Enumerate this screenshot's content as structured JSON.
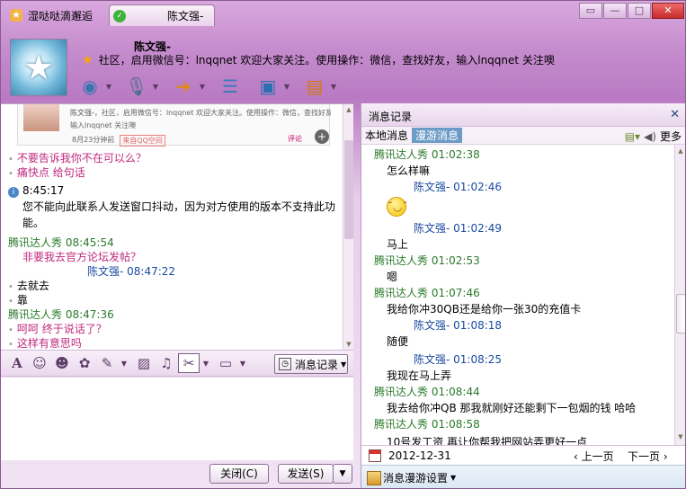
{
  "window": {
    "tabs": [
      {
        "label": "湿哒哒滴邂逅"
      },
      {
        "label": "陈文强-"
      }
    ],
    "buttons": {
      "minimize": "▭",
      "restore": "—",
      "maximize": "□",
      "close": "✕"
    }
  },
  "contact": {
    "name": "陈文强-",
    "signature": "社区，启用微信号：lnqqnet 欢迎大家关注。使用操作：微信，查找好友，输入lnqqnet 关注噢"
  },
  "top_toolbar": [
    {
      "icon": "webcam-icon",
      "glyph": "◉"
    },
    {
      "icon": "microphone-icon",
      "glyph": "♪"
    },
    {
      "icon": "transfer-file-icon",
      "glyph": "➔"
    },
    {
      "icon": "message-icon",
      "glyph": "☰"
    },
    {
      "icon": "remote-desktop-icon",
      "glyph": "▣"
    },
    {
      "icon": "app-icon",
      "glyph": "▤"
    }
  ],
  "preview_card": {
    "name": "陈文强-",
    "title": "社区，启用微信号：lnqqnet 欢迎大家关注。使用操作：微信，查找好友，",
    "message": "输入lnqqnet 关注噢",
    "time": "8月23分钟前",
    "badge": "来自QQ空间",
    "comment": "评论"
  },
  "chat": {
    "lines": [
      {
        "type": "bullet",
        "text": "不要告诉我你不在可以么？",
        "style": "pink"
      },
      {
        "type": "bullet",
        "text": "痛快点   给句话",
        "style": "pink"
      },
      {
        "type": "sys",
        "text": "8:45:17"
      },
      {
        "type": "plain",
        "text": "您不能向此联系人发送窗口抖动，因为对方使用的版本不支持此功"
      },
      {
        "type": "plain",
        "text": "能。"
      },
      {
        "type": "sender",
        "text": "腾讯达人秀   08:45:54"
      },
      {
        "type": "indent",
        "text": "非要我去官方论坛发帖？",
        "style": "pink"
      },
      {
        "type": "sender-blue",
        "text": "陈文强-   08:47:22"
      },
      {
        "type": "bullet",
        "text": "去就去",
        "style": ""
      },
      {
        "type": "bullet",
        "text": "靠",
        "style": ""
      },
      {
        "type": "sender",
        "text": "腾讯达人秀   08:47:36"
      },
      {
        "type": "bullet",
        "text": "呵呵   终于说话了？",
        "style": "pink"
      },
      {
        "type": "bullet",
        "text": "这样有意思吗",
        "style": "pink"
      }
    ]
  },
  "format_toolbar": {
    "icons": [
      "font-icon",
      "emoji-icon",
      "magic-face-icon",
      "shake-icon",
      "edit-icon",
      "image-icon",
      "music-icon",
      "screenshot-icon",
      "gift-icon"
    ],
    "history_label": "消息记录"
  },
  "bottom": {
    "close_label": "关闭(C)",
    "send_label": "发送(S)"
  },
  "history": {
    "title": "消息记录",
    "tab_local": "本地消息",
    "tab_roam": "漫游消息",
    "more": "更多",
    "entries": [
      {
        "kind": "sender",
        "text": "腾讯达人秀  01:02:38",
        "color": "green"
      },
      {
        "kind": "msg",
        "text": "怎么样嘛"
      },
      {
        "kind": "sender",
        "text": "陈文强-  01:02:46",
        "color": "blue"
      },
      {
        "kind": "emoji",
        "text": ""
      },
      {
        "kind": "sender",
        "text": "陈文强-  01:02:49",
        "color": "blue"
      },
      {
        "kind": "msg",
        "text": "马上"
      },
      {
        "kind": "sender",
        "text": "腾讯达人秀  01:02:53",
        "color": "green"
      },
      {
        "kind": "msg",
        "text": "嗯"
      },
      {
        "kind": "sender",
        "text": "腾讯达人秀  01:07:46",
        "color": "green"
      },
      {
        "kind": "msg",
        "text": "我给你冲30QB还是给你一张30的充值卡"
      },
      {
        "kind": "sender",
        "text": "陈文强-  01:08:18",
        "color": "blue"
      },
      {
        "kind": "msg",
        "text": "随便"
      },
      {
        "kind": "sender",
        "text": "陈文强-  01:08:25",
        "color": "blue"
      },
      {
        "kind": "msg",
        "text": "我现在马上弄"
      },
      {
        "kind": "sender",
        "text": "腾讯达人秀  01:08:44",
        "color": "green"
      },
      {
        "kind": "msg",
        "text": " 我去给你冲QB  那我就刚好还能剩下一包烟的钱  哈哈"
      },
      {
        "kind": "sender",
        "text": "腾讯达人秀  01:08:58",
        "color": "green"
      },
      {
        "kind": "msg",
        "text": "10号发工资 再让你帮我把网站弄更好一点"
      }
    ],
    "date": "2012-12-31",
    "prev_page": "上一页",
    "next_page": "下一页",
    "settings": "消息漫游设置"
  }
}
